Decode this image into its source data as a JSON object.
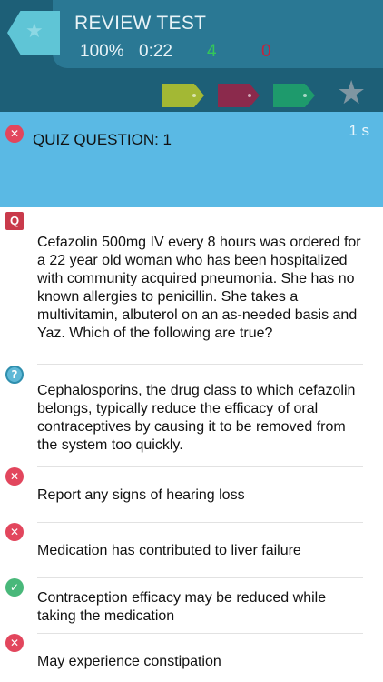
{
  "header": {
    "title": "REVIEW TEST",
    "score": "100%",
    "time": "0:22",
    "correct_count": "4",
    "wrong_count": "0"
  },
  "tags": [
    {
      "name": "yellow-tag",
      "color": "#a3b834"
    },
    {
      "name": "red-tag",
      "color": "#8b2a4c"
    },
    {
      "name": "green-tag",
      "color": "#1e9a6c"
    }
  ],
  "banner": {
    "title": "QUIZ QUESTION: 1",
    "timer": "1 s"
  },
  "question": {
    "badge": "Q",
    "text": "Cefazolin 500mg IV every 8 hours was ordered for a 22 year old woman who has been hospitalized with community acquired pneumonia. She has no known allergies to penicillin. She takes a multivitamin, albuterol on an as-needed basis and Yaz. Which of the following are true?"
  },
  "answers": [
    {
      "status": "unknown",
      "text": "Cephalosporins, the drug class to which cefazolin belongs, typically reduce the efficacy of oral contraceptives by causing it to be removed from the system too quickly."
    },
    {
      "status": "wrong",
      "text": "Report any signs of hearing loss"
    },
    {
      "status": "wrong",
      "text": "Medication has contributed to liver failure"
    },
    {
      "status": "correct",
      "text": "Contraception efficacy may be reduced while taking the medication"
    },
    {
      "status": "wrong",
      "text": "May experience constipation"
    }
  ],
  "colors": {
    "header_bg": "#1d5f77",
    "header_card": "#2a7894",
    "banner_bg": "#5ab9e4",
    "correct": "#34c759",
    "wrong": "#c3243c"
  }
}
